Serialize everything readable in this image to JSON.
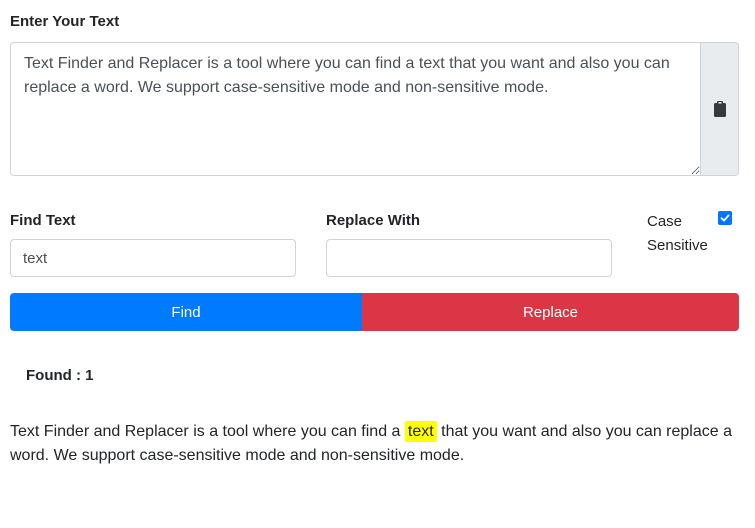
{
  "input": {
    "label": "Enter Your Text",
    "value": "Text Finder and Replacer is a tool where you can find a text that you want and also you can replace a word. We support case-sensitive mode and non-sensitive mode.",
    "addon_icon": "clipboard-icon"
  },
  "find": {
    "label": "Find Text",
    "value": "text"
  },
  "replace": {
    "label": "Replace With",
    "value": ""
  },
  "case_sensitive": {
    "label": "Case Sensitive",
    "checked": true
  },
  "buttons": {
    "find_label": "Find",
    "replace_label": "Replace"
  },
  "result": {
    "found_text": "Found : 1",
    "before": "Text Finder and Replacer is a tool where you can find a ",
    "match": "text",
    "after": " that you want and also you can replace a word. We support case-sensitive mode and non-sensitive mode."
  },
  "colors": {
    "find_button": "#007bff",
    "replace_button": "#dc3545",
    "highlight": "#ffff00"
  }
}
